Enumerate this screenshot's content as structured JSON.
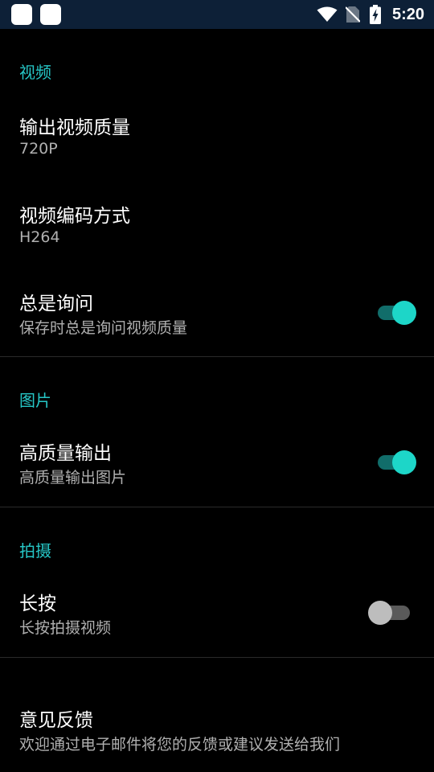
{
  "status_bar": {
    "time": "5:20",
    "colors": {
      "background": "#0d2037"
    },
    "icons": [
      "app-notification-icon",
      "app-notification-icon",
      "wifi-icon",
      "no-sim-icon",
      "battery-charging-icon"
    ]
  },
  "colors": {
    "accent": "#26c6c6",
    "background": "#000000",
    "switch_on": "#1dd6c8",
    "switch_off": "#bdbdbd"
  },
  "sections": {
    "video": {
      "header": "视频",
      "output_quality": {
        "title": "输出视频质量",
        "summary": "720P"
      },
      "encoding": {
        "title": "视频编码方式",
        "summary": "H264"
      },
      "always_ask": {
        "title": "总是询问",
        "summary": "保存时总是询问视频质量",
        "enabled": true
      }
    },
    "picture": {
      "header": "图片",
      "high_quality": {
        "title": "高质量输出",
        "summary": "高质量输出图片",
        "enabled": true
      }
    },
    "capture": {
      "header": "拍摄",
      "long_press": {
        "title": "长按",
        "summary": "长按拍摄视频",
        "enabled": false
      }
    },
    "feedback": {
      "title": "意见反馈",
      "summary": "欢迎通过电子邮件将您的反馈或建议发送给我们"
    }
  }
}
